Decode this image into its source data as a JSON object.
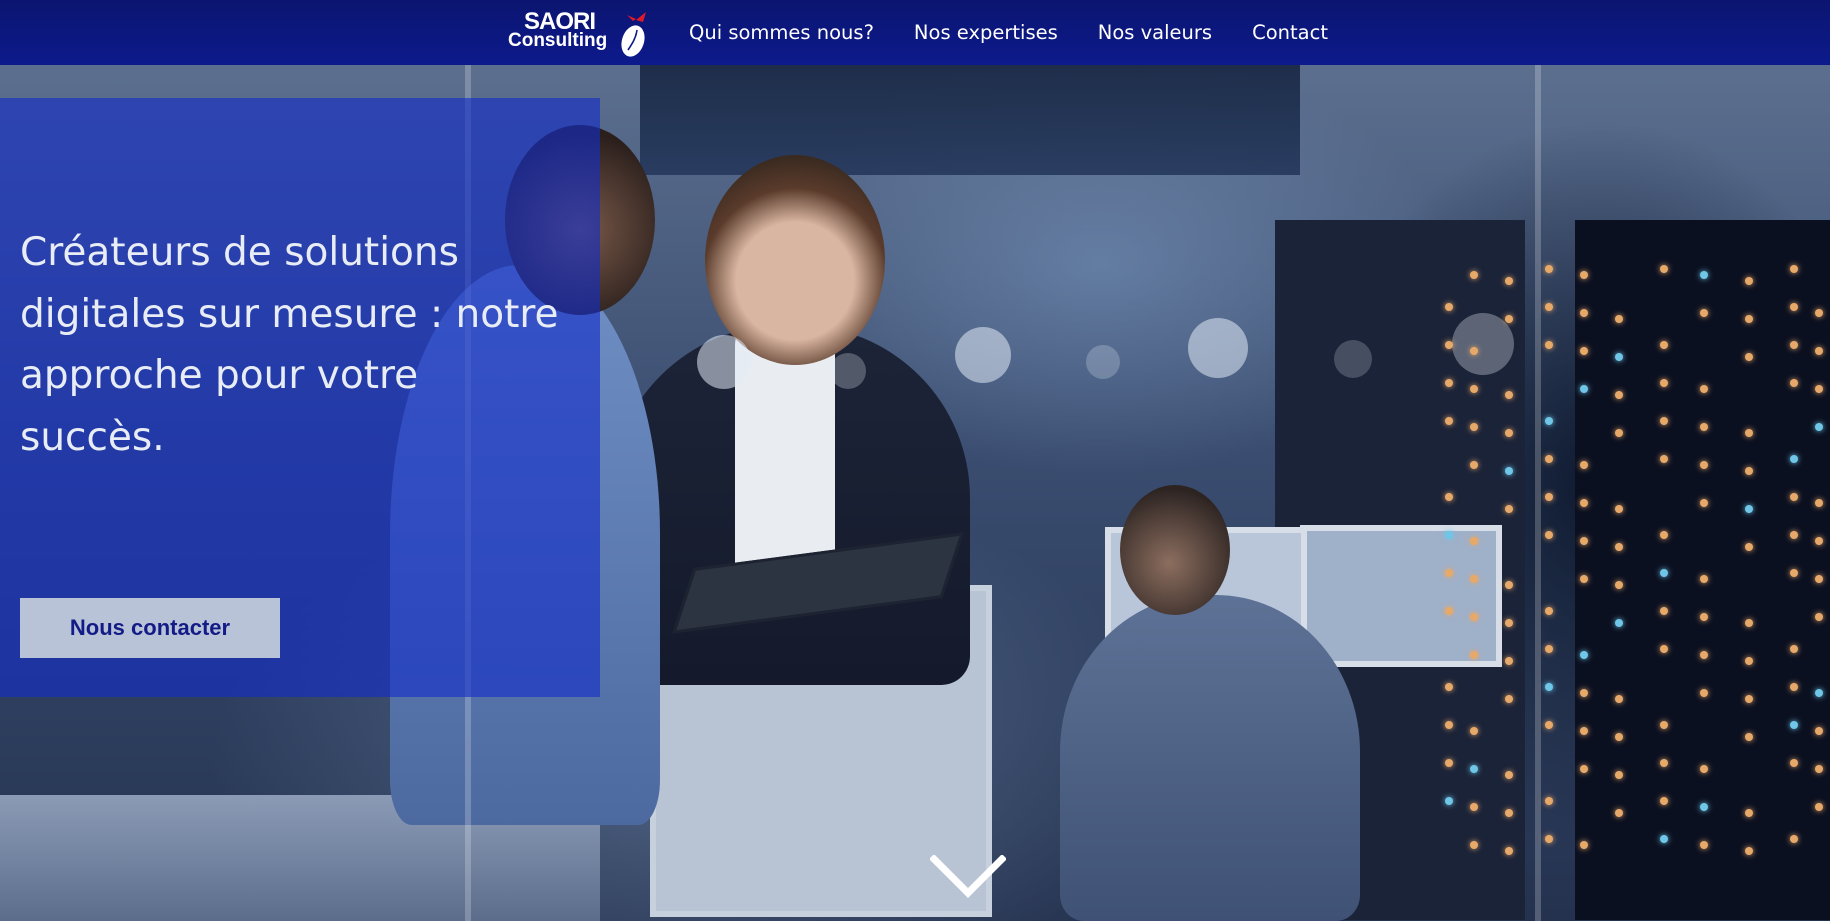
{
  "header": {
    "logo": {
      "line1": "SAORI",
      "line2": "Consulting",
      "icon": "saori-bird-egg-icon"
    },
    "nav": [
      {
        "label": "Qui sommes nous?"
      },
      {
        "label": "Nos expertises"
      },
      {
        "label": "Nos valeurs"
      },
      {
        "label": "Contact"
      }
    ]
  },
  "hero": {
    "title": "Créateurs de solutions digitales sur mesure : notre approche pour votre succès.",
    "cta_label": "Nous contacter",
    "scroll_icon": "chevron-down-icon"
  },
  "colors": {
    "nav_background": "#0c1a8c",
    "hero_overlay": "#142dc8",
    "cta_background": "#b9c3d8",
    "cta_text": "#131c86",
    "logo_accent": "#e0192b"
  }
}
